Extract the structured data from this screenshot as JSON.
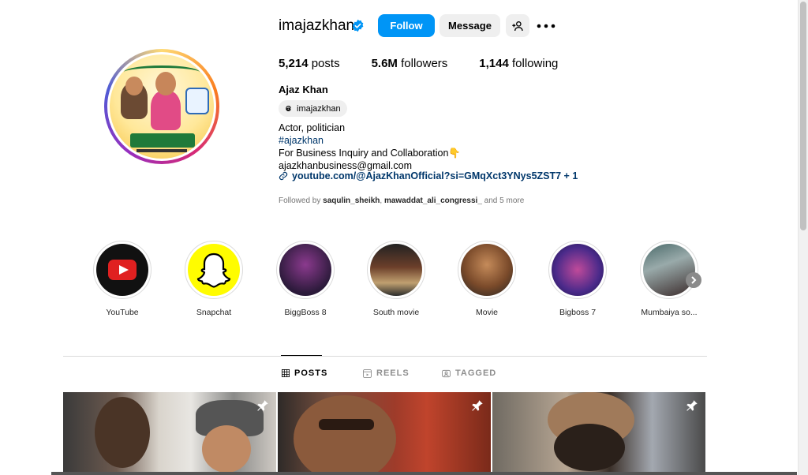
{
  "profile": {
    "username": "imajazkhan",
    "follow_label": "Follow",
    "message_label": "Message",
    "stats": {
      "posts_count": "5,214",
      "posts_label": " posts",
      "followers_count": "5.6M",
      "followers_label": " followers",
      "following_count": "1,144",
      "following_label": " following"
    },
    "full_name": "Ajaz Khan",
    "threads_handle": "imajazkhan",
    "bio": {
      "line1": "Actor, politician",
      "hashtag": "#ajazkhan",
      "line3": "For Business Inquiry and Collaboration👇",
      "email": "ajazkhanbusiness@gmail.com"
    },
    "link_text": "youtube.com/@AjazKhanOfficial?si=GMqXct3YNys5ZST7 + 1",
    "followed_by": {
      "prefix": "Followed by ",
      "user1": "saqulin_sheikh",
      "separator": ", ",
      "user2": "mawaddat_ali_congressi_",
      "suffix": " and 5 more"
    }
  },
  "highlights": [
    {
      "label": "YouTube"
    },
    {
      "label": "Snapchat"
    },
    {
      "label": "BiggBoss 8"
    },
    {
      "label": "South movie"
    },
    {
      "label": "Movie"
    },
    {
      "label": "Bigboss 7"
    },
    {
      "label": "Mumbaiya so..."
    }
  ],
  "tabs": {
    "posts": "POSTS",
    "reels": "REELS",
    "tagged": "TAGGED"
  },
  "icons": {
    "verified": "verified-badge-icon",
    "add_user": "add-person-icon",
    "more": "more-horizontal-icon",
    "threads": "threads-icon",
    "link": "link-icon",
    "pin": "pin-icon"
  },
  "colors": {
    "accent": "#0095f6",
    "link": "#00376b",
    "muted": "#737373"
  }
}
